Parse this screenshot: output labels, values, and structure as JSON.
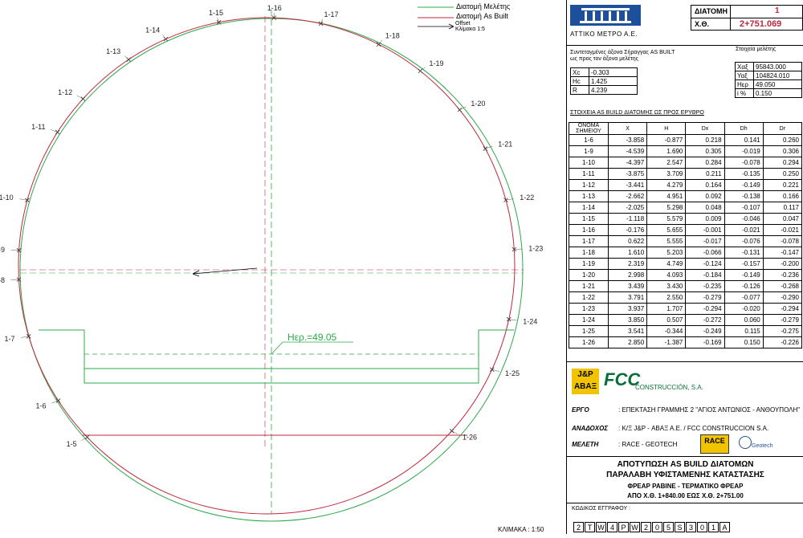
{
  "legend": {
    "design": "Διατομή Μελέτης",
    "asbuilt": "Διατομή As Built",
    "offset": "Offset",
    "scale": "Κλίμακα 1:5"
  },
  "colors": {
    "design": "#2ea84a",
    "asbuilt": "#c0283a",
    "axis": "#2ea84a"
  },
  "drawing": {
    "level_label": "Ηερ.=49.05",
    "scale_note": "ΚΛΙΜΑΚΑ : 1:50",
    "points": [
      {
        "id": "1-5",
        "X": -4.2,
        "H": -2.3
      },
      {
        "id": "1-6",
        "X": -3.858,
        "H": -0.877
      },
      {
        "id": "1-7",
        "X": -4.1,
        "H": 0.3
      },
      {
        "id": "1-8",
        "X": -4.35,
        "H": 1.2
      },
      {
        "id": "1-9",
        "X": -4.539,
        "H": 1.69
      },
      {
        "id": "1-10",
        "X": -4.397,
        "H": 2.547
      },
      {
        "id": "1-11",
        "X": -3.875,
        "H": 3.709
      },
      {
        "id": "1-12",
        "X": -3.441,
        "H": 4.279
      },
      {
        "id": "1-13",
        "X": -2.662,
        "H": 4.951
      },
      {
        "id": "1-14",
        "X": -2.025,
        "H": 5.298
      },
      {
        "id": "1-15",
        "X": -1.118,
        "H": 5.579
      },
      {
        "id": "1-16",
        "X": -0.176,
        "H": 5.655
      },
      {
        "id": "1-17",
        "X": 0.622,
        "H": 5.555
      },
      {
        "id": "1-18",
        "X": 1.61,
        "H": 5.203
      },
      {
        "id": "1-19",
        "X": 2.319,
        "H": 4.749
      },
      {
        "id": "1-20",
        "X": 2.998,
        "H": 4.093
      },
      {
        "id": "1-21",
        "X": 3.439,
        "H": 3.43
      },
      {
        "id": "1-22",
        "X": 3.791,
        "H": 2.55
      },
      {
        "id": "1-23",
        "X": 3.937,
        "H": 1.707
      },
      {
        "id": "1-24",
        "X": 3.85,
        "H": 0.507
      },
      {
        "id": "1-25",
        "X": 3.541,
        "H": -0.344
      },
      {
        "id": "1-26",
        "X": 2.85,
        "H": -1.387
      }
    ]
  },
  "header": {
    "company": "ΑΤΤΙΚΟ ΜΕΤΡΟ Α.Ε.",
    "section_label": "ΔΙΑΤΟΜΗ",
    "section_value": "1",
    "chainage_label": "Χ.Θ.",
    "chainage_value": "2+751.069"
  },
  "coords": {
    "title_line1": "Συντεταγμένες άξονα Σήραγγας AS BUILT",
    "title_line2": "ως προς τον άξονα μελέτης",
    "rows": [
      {
        "k": "Xc",
        "v": "-0.303"
      },
      {
        "k": "Hc",
        "v": "1.425"
      },
      {
        "k": "R",
        "v": "4.239"
      }
    ]
  },
  "study": {
    "title": "Στοιχεία μελέτης",
    "rows": [
      {
        "k": "Χαξ",
        "v": "95843.000"
      },
      {
        "k": "Υαξ",
        "v": "104824.010"
      },
      {
        "k": "Ηερ",
        "v": "49.050"
      },
      {
        "k": "i %",
        "v": "0.150"
      }
    ]
  },
  "asbuilt_table": {
    "title": "ΣΤΟΙΧΕΙΑ AS BUILD ΔΙΑΤΟΜΗΣ ΩΣ ΠΡΟΣ ΕΡΥΘΡΟ",
    "headers": [
      "ΟΝΟΜΑ ΣΗΜΕΙΟΥ",
      "X",
      "H",
      "Dx",
      "Dh",
      "Dr"
    ],
    "rows": [
      [
        "1-6",
        "-3.858",
        "-0.877",
        "0.218",
        "0.141",
        "0.260"
      ],
      [
        "1-9",
        "-4.539",
        "1.690",
        "0.305",
        "-0.019",
        "0.306"
      ],
      [
        "1-10",
        "-4.397",
        "2.547",
        "0.284",
        "-0.078",
        "0.294"
      ],
      [
        "1-11",
        "-3.875",
        "3.709",
        "0.211",
        "-0.135",
        "0.250"
      ],
      [
        "1-12",
        "-3.441",
        "4.279",
        "0.164",
        "-0.149",
        "0.221"
      ],
      [
        "1-13",
        "-2.662",
        "4.951",
        "0.092",
        "-0.138",
        "0.166"
      ],
      [
        "1-14",
        "-2.025",
        "5.298",
        "0.048",
        "-0.107",
        "0.117"
      ],
      [
        "1-15",
        "-1.118",
        "5.579",
        "0.009",
        "-0.046",
        "0.047"
      ],
      [
        "1-16",
        "-0.176",
        "5.655",
        "-0.001",
        "-0.021",
        "-0.021"
      ],
      [
        "1-17",
        "0.622",
        "5.555",
        "-0.017",
        "-0.076",
        "-0.078"
      ],
      [
        "1-18",
        "1.610",
        "5.203",
        "-0.066",
        "-0.131",
        "-0.147"
      ],
      [
        "1-19",
        "2.319",
        "4.749",
        "-0.124",
        "-0.157",
        "-0.200"
      ],
      [
        "1-20",
        "2.998",
        "4.093",
        "-0.184",
        "-0.149",
        "-0.236"
      ],
      [
        "1-21",
        "3.439",
        "3.430",
        "-0.235",
        "-0.126",
        "-0.268"
      ],
      [
        "1-22",
        "3.791",
        "2.550",
        "-0.279",
        "-0.077",
        "-0.290"
      ],
      [
        "1-23",
        "3.937",
        "1.707",
        "-0.294",
        "-0.020",
        "-0.294"
      ],
      [
        "1-24",
        "3.850",
        "0.507",
        "-0.272",
        "0.060",
        "-0.279"
      ],
      [
        "1-25",
        "3.541",
        "-0.344",
        "-0.249",
        "0.115",
        "-0.275"
      ],
      [
        "1-26",
        "2.850",
        "-1.387",
        "-0.169",
        "0.150",
        "-0.226"
      ]
    ]
  },
  "contractor": {
    "jp_logo": "J&P ΑΒΑΞ",
    "fcc_logo": "FCC",
    "fcc_text": "CONSTRUCCIÓN, S.A.",
    "project_label": "ΕΡΓΟ",
    "project_value": ": ΕΠΕΚΤΑΣΗ ΓΡΑΜΜΗΣ 2 \"ΑΓΙΟΣ ΑΝΤΩΝΙΟΣ - ΑΝΘΟΥΠΟΛΗ\"",
    "contractor_label": "ΑΝΑΔΟΧΟΣ",
    "contractor_value": ": Κ/Ξ J&P - ΑΒΑΞ Α.Ε. / FCC CONSTRUCCION S.A.",
    "study_label": "ΜΕΛΕΤΗ",
    "study_value": ": RACE - GEOTECH",
    "race_logo": "RACE",
    "geotech_logo": "Geotech"
  },
  "title_block": {
    "line1": "ΑΠΟΤΥΠΩΣΗ AS BUILD ΔΙΑΤΟΜΩΝ",
    "line2": "ΠΑΡΑΛΑΒΗ ΥΦΙΣΤΑΜΕΝΗΣ ΚΑΤΑΣΤΑΣΗΣ",
    "line3": "ΦΡΕΑΡ ΡΑΒΙΝΕ - ΤΕΡΜΑΤΙΚΟ ΦΡΕΑΡ",
    "line4": "ΑΠΟ Χ.Θ. 1+840.00 ΕΩΣ Χ.Θ. 2+751.00"
  },
  "drawing_code": {
    "label": "ΚΩΔΙΚΟΣ ΕΓΓΡΑΦΟΥ :",
    "chars": [
      "2",
      "T",
      "W",
      "4",
      "P",
      "W",
      "2",
      "0",
      "5",
      "S",
      "3",
      "0",
      "1",
      "A"
    ]
  }
}
